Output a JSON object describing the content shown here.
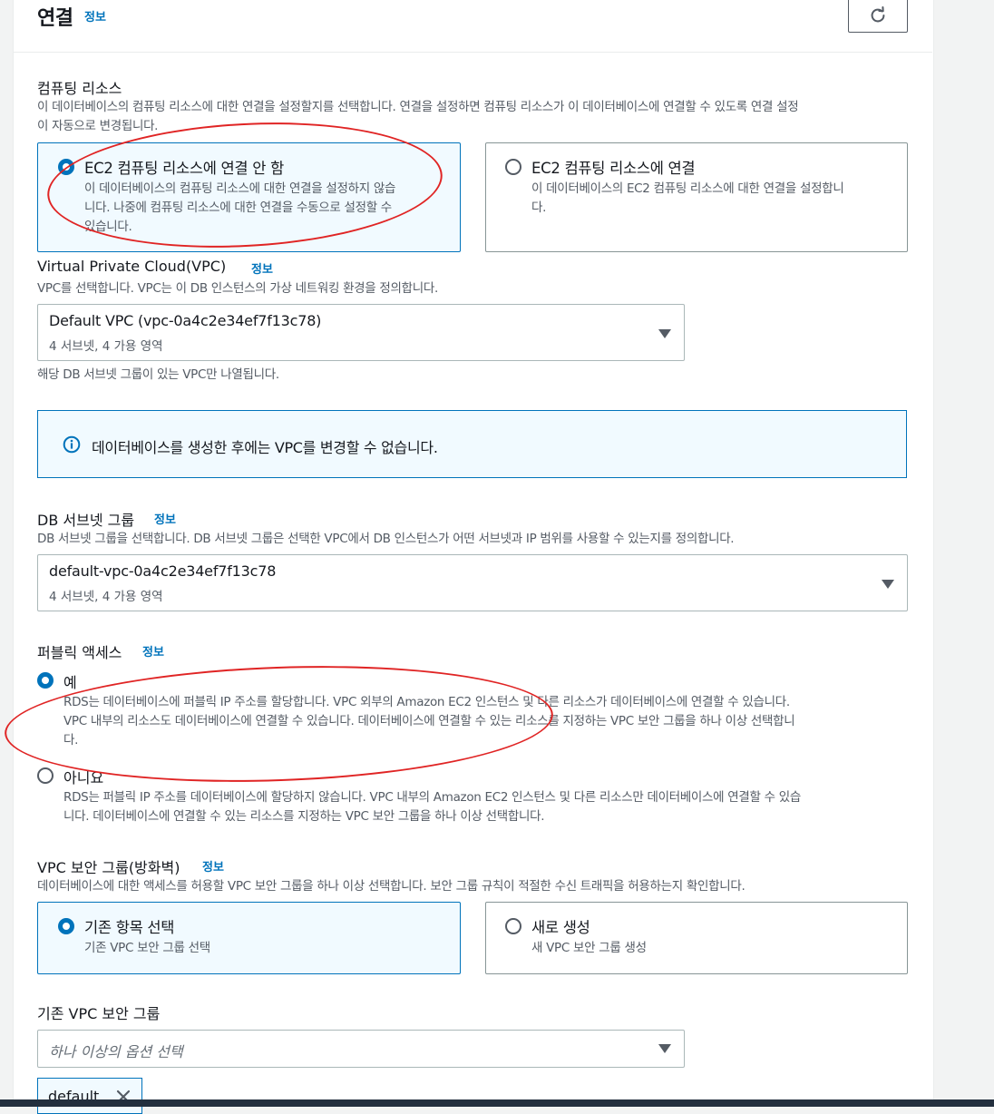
{
  "header": {
    "title": "연결",
    "info": "정보"
  },
  "compute": {
    "label": "컴퓨팅 리소스",
    "desc_line1": "이 데이터베이스의 컴퓨팅 리소스에 대한 연결을 설정할지를 선택합니다. 연결을 설정하면 컴퓨팅 리소스가 이 데이터베이스에 연결할 수 있도록 연결 설정",
    "desc_line2": "이 자동으로 변경됩니다.",
    "options": [
      {
        "title": "EC2 컴퓨팅 리소스에 연결 안 함",
        "desc_line1": "이 데이터베이스의 컴퓨팅 리소스에 대한 연결을 설정하지 않습",
        "desc_line2": "니다. 나중에 컴퓨팅 리소스에 대한 연결을 수동으로 설정할 수",
        "desc_line3": "있습니다.",
        "selected": true
      },
      {
        "title": "EC2 컴퓨팅 리소스에 연결",
        "desc_line1": "이 데이터베이스의 EC2 컴퓨팅 리소스에 대한 연결을 설정합니",
        "desc_line2": "다.",
        "selected": false
      }
    ]
  },
  "vpc": {
    "label": "Virtual Private Cloud(VPC)",
    "info": "정보",
    "desc": "VPC를 선택합니다. VPC는 이 DB 인스턴스의 가상 네트워킹 환경을 정의합니다.",
    "selected": "Default VPC (vpc-0a4c2e34ef7f13c78)",
    "selected_sub": "4 서브넷, 4 가용 영역",
    "hint": "해당 DB 서브넷 그룹이 있는 VPC만 나열됩니다."
  },
  "vpc_notice": {
    "text": "데이터베이스를 생성한 후에는 VPC를 변경할 수 없습니다."
  },
  "subnet": {
    "label": "DB 서브넷 그룹",
    "info": "정보",
    "desc": "DB 서브넷 그룹을 선택합니다. DB 서브넷 그룹은 선택한 VPC에서 DB 인스턴스가 어떤 서브넷과 IP 범위를 사용할 수 있는지를 정의합니다.",
    "selected": "default-vpc-0a4c2e34ef7f13c78",
    "selected_sub": "4 서브넷, 4 가용 영역"
  },
  "public_access": {
    "label": "퍼블릭 액세스",
    "info": "정보",
    "options": [
      {
        "title": "예",
        "desc_line1": "RDS는 데이터베이스에 퍼블릭 IP 주소를 할당합니다. VPC 외부의 Amazon EC2 인스턴스 및 다른 리소스가 데이터베이스에 연결할 수 있습니다.",
        "desc_line2": "VPC 내부의 리소스도 데이터베이스에 연결할 수 있습니다. 데이터베이스에 연결할 수 있는 리소스를 지정하는 VPC 보안 그룹을 하나 이상 선택합니",
        "desc_line3": "다.",
        "selected": true
      },
      {
        "title": "아니요",
        "desc_line1": "RDS는 퍼블릭 IP 주소를 데이터베이스에 할당하지 않습니다. VPC 내부의 Amazon EC2 인스턴스 및 다른 리소스만 데이터베이스에 연결할 수 있습",
        "desc_line2": "니다. 데이터베이스에 연결할 수 있는 리소스를 지정하는 VPC 보안 그룹을 하나 이상 선택합니다.",
        "selected": false
      }
    ]
  },
  "security_group": {
    "label": "VPC 보안 그룹(방화벽)",
    "info": "정보",
    "desc": "데이터베이스에 대한 액세스를 허용할 VPC 보안 그룹을 하나 이상 선택합니다. 보안 그룹 규칙이 적절한 수신 트래픽을 허용하는지 확인합니다.",
    "options": [
      {
        "title": "기존 항목 선택",
        "desc": "기존 VPC 보안 그룹 선택",
        "selected": true
      },
      {
        "title": "새로 생성",
        "desc": "새 VPC 보안 그룹 생성",
        "selected": false
      }
    ]
  },
  "existing_sg": {
    "label": "기존 VPC 보안 그룹",
    "placeholder": "하나 이상의 옵션 선택",
    "tokens": [
      "default"
    ]
  },
  "colors": {
    "accent": "#0073bb",
    "annotation": "#e02424",
    "selected_bg": "#f1faff"
  },
  "icons": {
    "refresh": "refresh-icon",
    "caret": "caret-down-icon",
    "info": "info-circle-icon",
    "remove": "close-icon"
  }
}
